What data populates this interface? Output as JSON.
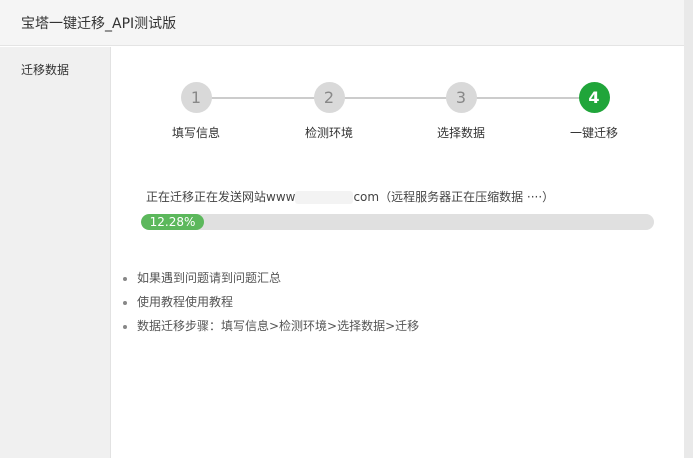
{
  "window": {
    "title": "宝塔一键迁移_API测试版"
  },
  "sidebar": {
    "items": [
      {
        "label": "迁移数据"
      }
    ]
  },
  "steps": [
    {
      "number": "1",
      "label": "填写信息",
      "active": false
    },
    {
      "number": "2",
      "label": "检测环境",
      "active": false
    },
    {
      "number": "3",
      "label": "选择数据",
      "active": false
    },
    {
      "number": "4",
      "label": "一键迁移",
      "active": true
    }
  ],
  "status": {
    "prefix": "正在迁移正在发送网站www",
    "suffix": "com（远程服务器正在压缩数据 ····）"
  },
  "progress": {
    "percent": 12.28,
    "label": "12.28%"
  },
  "tips": [
    "如果遇到问题请到问题汇总",
    "使用教程使用教程",
    "数据迁移步骤：填写信息>检测环境>选择数据>迁移"
  ],
  "colors": {
    "accent": "#20a53a",
    "progress": "#5cb85c",
    "inactive_step": "#d9d9d9"
  }
}
